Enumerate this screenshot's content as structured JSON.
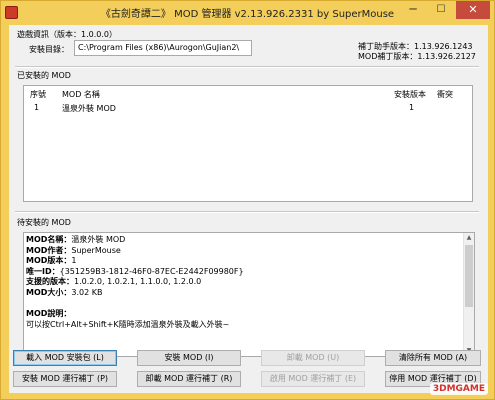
{
  "window": {
    "title": "《古劍奇譚二》 MOD 管理器 v2.13.926.2331 by SuperMouse",
    "minimize": "─",
    "maximize": "☐",
    "close": "✕"
  },
  "game_info": {
    "heading": "遊戲資訊（版本：1.0.0.0）",
    "install_dir_label": "安裝目錄：",
    "install_dir_value": "C:\\Program Files (x86)\\Aurogon\\GuJian2\\",
    "patch_helper_version": "補丁助手版本：1.13.926.1243",
    "mod_patch_version": "MOD補丁版本：1.13.926.2127"
  },
  "installed": {
    "heading": "已安裝的 MOD",
    "columns": [
      "序號",
      "MOD 名稱",
      "安裝版本",
      "衝突"
    ],
    "rows": [
      {
        "index": "1",
        "name": "溫泉外裝 MOD",
        "version": "1",
        "conflict": ""
      }
    ]
  },
  "pending": {
    "heading": "待安裝的 MOD",
    "lines": [
      {
        "k": "MOD名稱：",
        "v": "溫泉外裝 MOD"
      },
      {
        "k": "MOD作者：",
        "v": "SuperMouse"
      },
      {
        "k": "MOD版本：",
        "v": "1"
      },
      {
        "k": "唯一ID：",
        "v": "{351259B3-1812-46F0-87EC-E2442F09980F}"
      },
      {
        "k": "支援的版本：",
        "v": "1.0.2.0, 1.0.2.1, 1.1.0.0, 1.2.0.0"
      },
      {
        "k": "MOD大小：",
        "v": "3.02 KB"
      },
      {
        "k": "",
        "v": ""
      },
      {
        "k": "MOD說明：",
        "v": ""
      },
      {
        "k": "",
        "v": "可以按Ctrl+Alt+Shift+K隨時添加溫泉外裝及載入外裝~"
      }
    ]
  },
  "buttons": {
    "load_pack": "載入 MOD 安裝包 (L)",
    "install_mod": "安裝 MOD (I)",
    "uninstall_mod": "卸載 MOD (U)",
    "clear_all": "清除所有 MOD (A)",
    "install_runtime": "安裝 MOD 運行補丁 (P)",
    "uninstall_runtime": "卸載 MOD 運行補丁 (R)",
    "enable_runtime": "啟用 MOD 運行補丁 (E)",
    "disable_runtime": "停用 MOD 運行補丁 (D)"
  },
  "watermark": "3DMGAME"
}
